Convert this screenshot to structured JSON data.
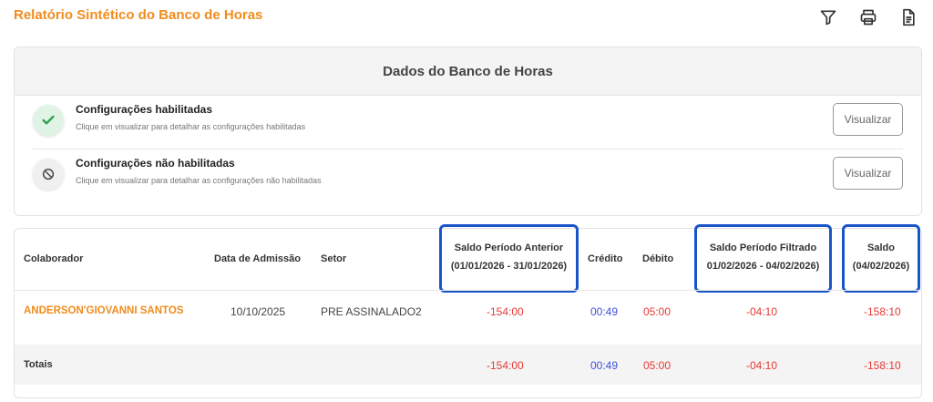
{
  "header": {
    "title": "Relatório Sintético do Banco de Horas",
    "icons": [
      "filter-icon",
      "print-icon",
      "document-icon"
    ]
  },
  "panel": {
    "title": "Dados do Banco de Horas",
    "enabled": {
      "title": "Configurações habilitadas",
      "desc": "Clique em visualizar para detalhar as configurações habilitadas",
      "button": "Visualizar"
    },
    "disabled": {
      "title": "Configurações não habilitadas",
      "desc": "Clique em visualizar para detalhar as configurações não habilitadas",
      "button": "Visualizar"
    }
  },
  "table": {
    "headers": {
      "colaborador": "Colaborador",
      "admissao": "Data de Admissão",
      "setor": "Setor",
      "saldo_anterior_1": "Saldo Período Anterior",
      "saldo_anterior_2": "(01/01/2026 - 31/01/2026)",
      "credito": "Crédito",
      "debito": "Débito",
      "saldo_filtrado_1": "Saldo Período Filtrado",
      "saldo_filtrado_2": "01/02/2026 - 04/02/2026)",
      "saldo_1": "Saldo",
      "saldo_2": "(04/02/2026)"
    },
    "row": {
      "colaborador": "ANDERSON'GIOVANNI SANTOS",
      "admissao": "10/10/2025",
      "setor": "PRE ASSINALADO2",
      "saldo_anterior": "-154:00",
      "credito": "00:49",
      "debito": "05:00",
      "saldo_filtrado": "-04:10",
      "saldo": "-158:10"
    },
    "totals": {
      "label": "Totais",
      "saldo_anterior": "-154:00",
      "credito": "00:49",
      "debito": "05:00",
      "saldo_filtrado": "-04:10",
      "saldo": "-158:10"
    }
  },
  "colors": {
    "accent": "#f08c1e",
    "highlight": "#1a55c8",
    "negative": "#e53935",
    "positive": "#3f51d9"
  }
}
